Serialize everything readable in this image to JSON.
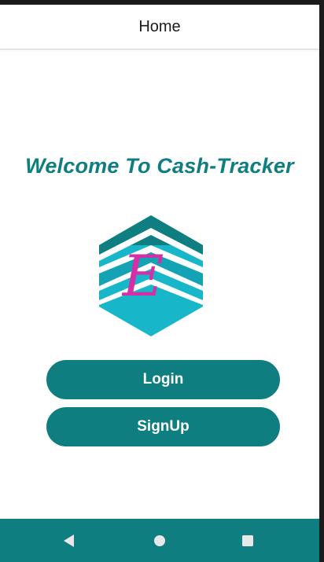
{
  "app_bar": {
    "title": "Home"
  },
  "main": {
    "welcome_text": "Welcome To Cash-Tracker",
    "logo": {
      "icon": "cash-tracker-logo-icon",
      "letter": "E"
    },
    "login_label": "Login",
    "signup_label": "SignUp"
  },
  "nav_bar": {
    "back_icon": "back-triangle-icon",
    "home_icon": "home-circle-icon",
    "recents_icon": "recents-square-icon"
  },
  "colors": {
    "primary": "#0f7e80",
    "logo_light": "#17b7c9",
    "logo_dark": "#0f7e80",
    "logo_letter": "#d52ea6",
    "background": "#ffffff"
  }
}
